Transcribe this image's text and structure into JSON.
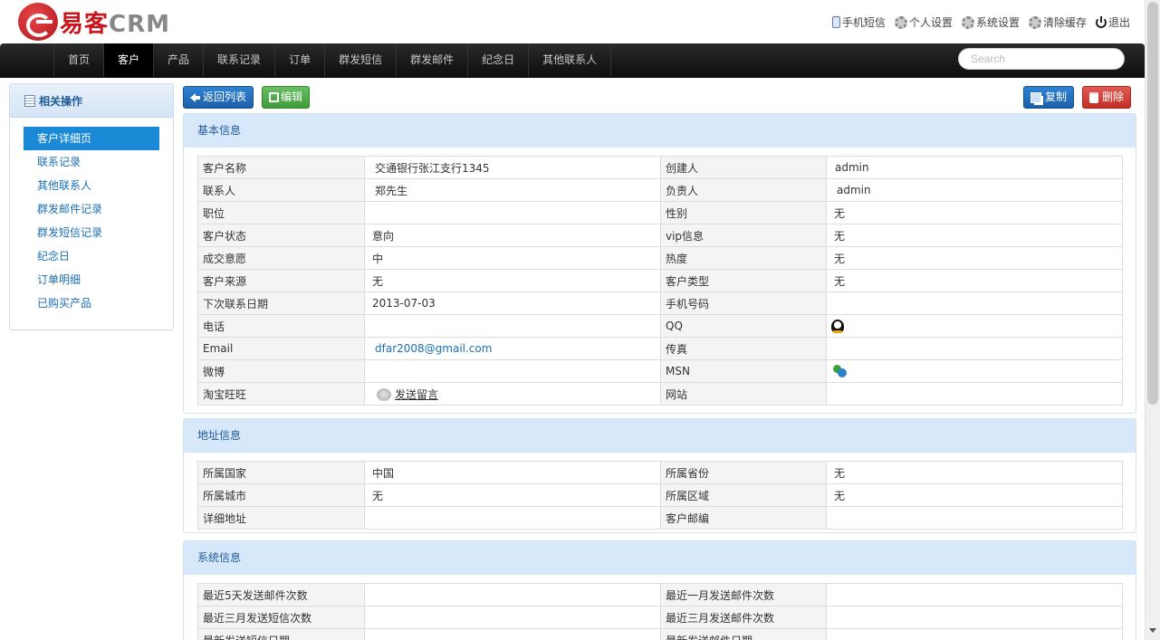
{
  "header": {
    "logo_main": "易客",
    "logo_sub": "CRM",
    "links": [
      {
        "icon": "phone-icon",
        "label": "手机短信"
      },
      {
        "icon": "gear-icon",
        "label": "个人设置"
      },
      {
        "icon": "gear-icon",
        "label": "系统设置"
      },
      {
        "icon": "gear-icon",
        "label": "清除缓存"
      },
      {
        "icon": "power-icon",
        "label": "退出"
      }
    ]
  },
  "nav": {
    "items": [
      "首页",
      "客户",
      "产品",
      "联系记录",
      "订单",
      "群发短信",
      "群发邮件",
      "纪念日",
      "其他联系人"
    ],
    "active_index": 1,
    "search_placeholder": "Search"
  },
  "sidebar": {
    "title": "相关操作",
    "items": [
      "客户详细页",
      "联系记录",
      "其他联系人",
      "群发邮件记录",
      "群发短信记录",
      "纪念日",
      "订单明细",
      "已购买产品"
    ],
    "active_index": 0
  },
  "toolbar": {
    "back_label": "返回列表",
    "edit_label": "编辑",
    "copy_label": "复制",
    "delete_label": "删除"
  },
  "basic": {
    "title": "基本信息",
    "rows": [
      [
        "客户名称",
        "交通银行张江支行1345",
        "创建人",
        "admin"
      ],
      [
        "联系人",
        "郑先生",
        "负责人",
        "admin"
      ],
      [
        "职位",
        "",
        "性别",
        "无"
      ],
      [
        "客户状态",
        "意向",
        "vip信息",
        "无"
      ],
      [
        "成交意愿",
        "中",
        "热度",
        "无"
      ],
      [
        "客户来源",
        "无",
        "客户类型",
        "无"
      ],
      [
        "下次联系日期",
        "2013-07-03",
        "手机号码",
        ""
      ],
      [
        "电话",
        "",
        "QQ",
        ""
      ],
      [
        "Email",
        "dfar2008@gmail.com",
        "传真",
        ""
      ],
      [
        "微博",
        "",
        "MSN",
        ""
      ],
      [
        "淘宝旺旺",
        "发送留言",
        "网站",
        ""
      ]
    ]
  },
  "address": {
    "title": "地址信息",
    "rows": [
      [
        "所属国家",
        "中国",
        "所属省份",
        "无"
      ],
      [
        "所属城市",
        "无",
        "所属区域",
        "无"
      ],
      [
        "详细地址",
        "",
        "客户邮编",
        ""
      ]
    ]
  },
  "system": {
    "title": "系统信息",
    "rows": [
      [
        "最近5天发送邮件次数",
        "",
        "最近一月发送邮件次数",
        ""
      ],
      [
        "最近三月发送短信次数",
        "",
        "最近三月发送邮件次数",
        ""
      ],
      [
        "最新发送短信日期",
        "",
        "最新发送邮件日期",
        ""
      ]
    ]
  }
}
